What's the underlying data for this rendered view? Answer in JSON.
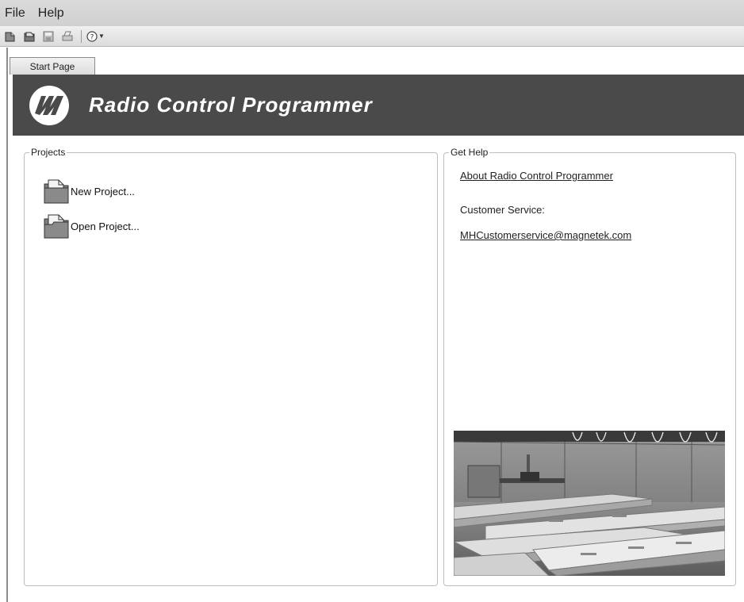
{
  "menu": {
    "file": "File",
    "help": "Help"
  },
  "toolbar": {
    "icons": [
      "new-icon",
      "open-icon",
      "save-icon",
      "print-icon",
      "help-icon"
    ]
  },
  "tabs": [
    {
      "label": "Start Page"
    }
  ],
  "banner": {
    "title": "Radio Control Programmer"
  },
  "projects": {
    "legend": "Projects",
    "new_project": "New Project...",
    "open_project": "Open Project..."
  },
  "get_help": {
    "legend": "Get Help",
    "about_link": "About Radio Control Programmer",
    "customer_service_label": "Customer Service:",
    "email_link": "MHCustomerservice@magnetek.com"
  },
  "colors": {
    "banner_bg": "#4a4a4a",
    "menubar_bg": "#d4d4d4"
  }
}
